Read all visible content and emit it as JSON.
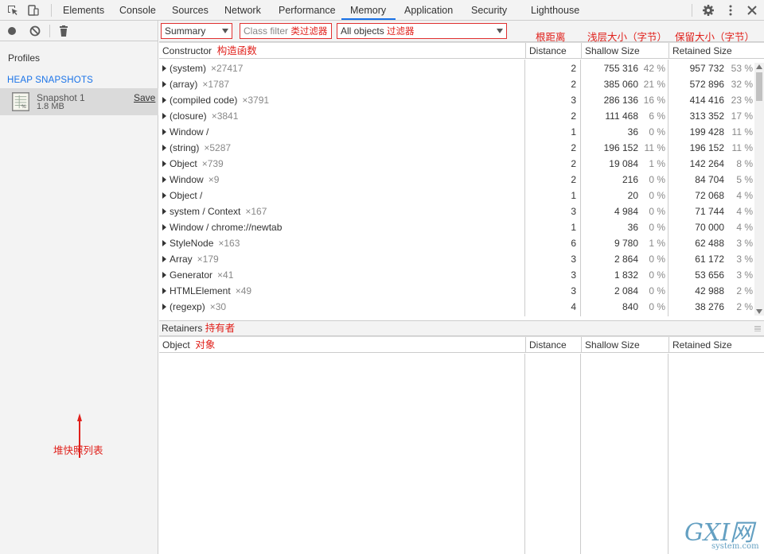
{
  "tabs": [
    "Elements",
    "Console",
    "Sources",
    "Network",
    "Performance",
    "Memory",
    "Application",
    "Security",
    "Lighthouse"
  ],
  "active_tab": "Memory",
  "sidebar": {
    "profiles_label": "Profiles",
    "section_label": "HEAP SNAPSHOTS",
    "snapshot": {
      "name": "Snapshot 1",
      "size": "1.8 MB",
      "save_label": "Save"
    },
    "annotation": "堆快照列表"
  },
  "toolbar": {
    "view_select": "Summary",
    "class_filter_placeholder": "Class filter",
    "class_filter_annotation": "类过滤器",
    "objects_select": "All objects",
    "objects_annotation": "过滤器",
    "ann_distance": "根距离",
    "ann_shallow": "浅层大小（字节）",
    "ann_retained": "保留大小（字节）"
  },
  "table": {
    "headers": {
      "constructor": "Constructor",
      "constructor_annotation": "构造函数",
      "distance": "Distance",
      "shallow": "Shallow Size",
      "retained": "Retained Size"
    },
    "rows": [
      {
        "name": "(system)",
        "count": "×27417",
        "distance": "2",
        "shallow": "755 316",
        "shallow_pct": "42 %",
        "retained": "957 732",
        "retained_pct": "53 %"
      },
      {
        "name": "(array)",
        "count": "×1787",
        "distance": "2",
        "shallow": "385 060",
        "shallow_pct": "21 %",
        "retained": "572 896",
        "retained_pct": "32 %"
      },
      {
        "name": "(compiled code)",
        "count": "×3791",
        "distance": "3",
        "shallow": "286 136",
        "shallow_pct": "16 %",
        "retained": "414 416",
        "retained_pct": "23 %"
      },
      {
        "name": "(closure)",
        "count": "×3841",
        "distance": "2",
        "shallow": "111 468",
        "shallow_pct": "6 %",
        "retained": "313 352",
        "retained_pct": "17 %"
      },
      {
        "name": "Window /",
        "count": "",
        "distance": "1",
        "shallow": "36",
        "shallow_pct": "0 %",
        "retained": "199 428",
        "retained_pct": "11 %"
      },
      {
        "name": "(string)",
        "count": "×5287",
        "distance": "2",
        "shallow": "196 152",
        "shallow_pct": "11 %",
        "retained": "196 152",
        "retained_pct": "11 %"
      },
      {
        "name": "Object",
        "count": "×739",
        "distance": "2",
        "shallow": "19 084",
        "shallow_pct": "1 %",
        "retained": "142 264",
        "retained_pct": "8 %"
      },
      {
        "name": "Window",
        "count": "×9",
        "distance": "2",
        "shallow": "216",
        "shallow_pct": "0 %",
        "retained": "84 704",
        "retained_pct": "5 %"
      },
      {
        "name": "Object /",
        "count": "",
        "distance": "1",
        "shallow": "20",
        "shallow_pct": "0 %",
        "retained": "72 068",
        "retained_pct": "4 %"
      },
      {
        "name": "system / Context",
        "count": "×167",
        "distance": "3",
        "shallow": "4 984",
        "shallow_pct": "0 %",
        "retained": "71 744",
        "retained_pct": "4 %"
      },
      {
        "name": "Window / chrome://newtab",
        "count": "",
        "distance": "1",
        "shallow": "36",
        "shallow_pct": "0 %",
        "retained": "70 000",
        "retained_pct": "4 %"
      },
      {
        "name": "StyleNode",
        "count": "×163",
        "distance": "6",
        "shallow": "9 780",
        "shallow_pct": "1 %",
        "retained": "62 488",
        "retained_pct": "3 %"
      },
      {
        "name": "Array",
        "count": "×179",
        "distance": "3",
        "shallow": "2 864",
        "shallow_pct": "0 %",
        "retained": "61 172",
        "retained_pct": "3 %"
      },
      {
        "name": "Generator",
        "count": "×41",
        "distance": "3",
        "shallow": "1 832",
        "shallow_pct": "0 %",
        "retained": "53 656",
        "retained_pct": "3 %"
      },
      {
        "name": "HTMLElement",
        "count": "×49",
        "distance": "3",
        "shallow": "2 084",
        "shallow_pct": "0 %",
        "retained": "42 988",
        "retained_pct": "2 %"
      },
      {
        "name": "(regexp)",
        "count": "×30",
        "distance": "4",
        "shallow": "840",
        "shallow_pct": "0 %",
        "retained": "38 276",
        "retained_pct": "2 %"
      }
    ]
  },
  "retainers": {
    "title": "Retainers",
    "title_annotation": "持有者",
    "headers": {
      "object": "Object",
      "object_annotation": "对象",
      "distance": "Distance",
      "shallow": "Shallow Size",
      "retained": "Retained Size"
    }
  },
  "watermark": {
    "brand": "GXI网",
    "site": "system.com"
  }
}
